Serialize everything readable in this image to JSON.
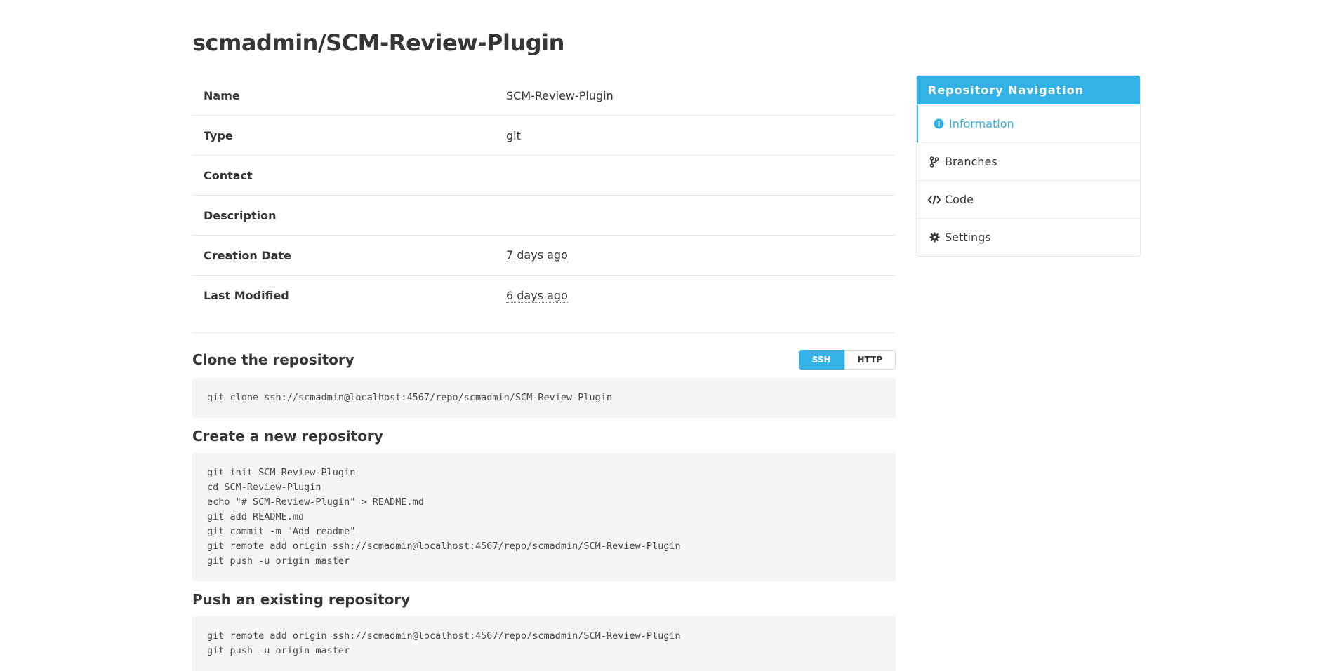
{
  "page": {
    "title": "scmadmin/SCM-Review-Plugin"
  },
  "info": {
    "rows": [
      {
        "label": "Name",
        "value": "SCM-Review-Plugin"
      },
      {
        "label": "Type",
        "value": "git"
      },
      {
        "label": "Contact",
        "value": ""
      },
      {
        "label": "Description",
        "value": ""
      },
      {
        "label": "Creation Date",
        "value": "7 days ago"
      },
      {
        "label": "Last Modified",
        "value": "6 days ago"
      }
    ]
  },
  "clone": {
    "title": "Clone the repository",
    "ssh_label": "SSH",
    "http_label": "HTTP",
    "active_protocol": "SSH",
    "command": "git clone ssh://scmadmin@localhost:4567/repo/scmadmin/SCM-Review-Plugin"
  },
  "create": {
    "title": "Create a new repository",
    "commands": "git init SCM-Review-Plugin\ncd SCM-Review-Plugin\necho \"# SCM-Review-Plugin\" > README.md\ngit add README.md\ngit commit -m \"Add readme\"\ngit remote add origin ssh://scmadmin@localhost:4567/repo/scmadmin/SCM-Review-Plugin\ngit push -u origin master"
  },
  "push": {
    "title": "Push an existing repository",
    "commands": "git remote add origin ssh://scmadmin@localhost:4567/repo/scmadmin/SCM-Review-Plugin\ngit push -u origin master"
  },
  "sidebar": {
    "title": "Repository Navigation",
    "items": [
      {
        "label": "Information",
        "icon": "info-circle-icon",
        "active": true
      },
      {
        "label": "Branches",
        "icon": "code-branch-icon",
        "active": false
      },
      {
        "label": "Code",
        "icon": "code-icon",
        "active": false
      },
      {
        "label": "Settings",
        "icon": "cog-icon",
        "active": false
      }
    ]
  },
  "colors": {
    "accent": "#33b2e8",
    "text": "#363636",
    "code_bg": "#f5f5f5"
  }
}
